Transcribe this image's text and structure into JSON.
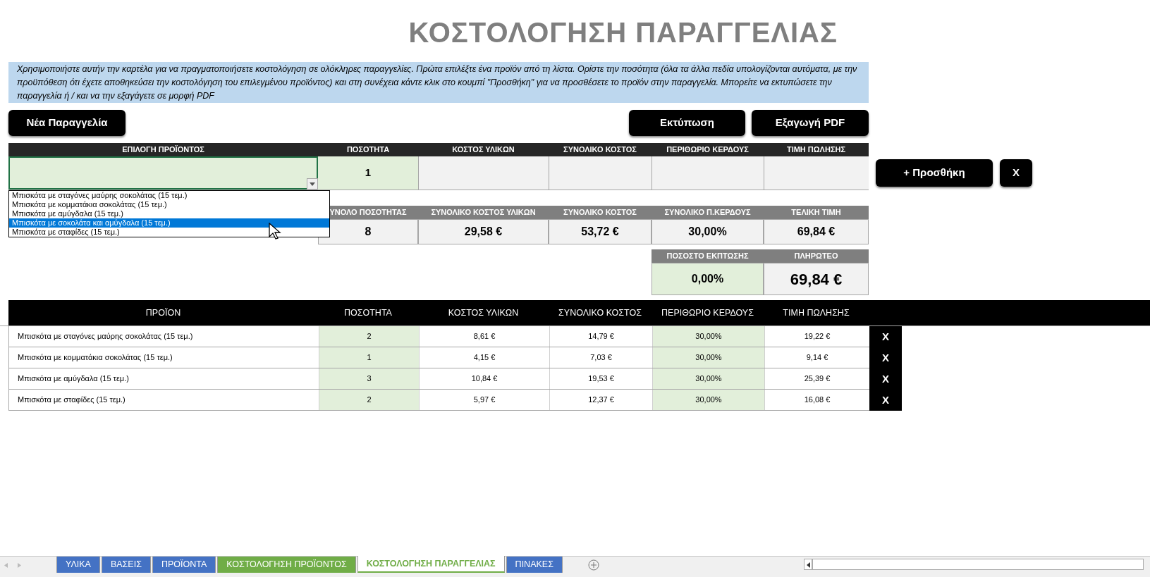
{
  "title": "ΚΟΣΤΟΛΟΓΗΣΗ ΠΑΡΑΓΓΕΛΙΑΣ",
  "info": "Χρησιμοποιήστε αυτήν την καρτέλα για να πραγματοποιήσετε κοστολόγηση σε ολόκληρες παραγγελίες. Πρώτα επιλέξτε ένα προϊόν από τη λίστα. Ορίστε την ποσότητα (όλα τα άλλα πεδία υπολογίζονται αυτόματα, με την προϋπόθεση ότι έχετε αποθηκεύσει την κοστολόγηση του επιλεγμένου προϊόντος) και στη συνέχεια κάντε κλικ στο κουμπί \"Προσθήκη\" για να προσθέσετε το προϊόν στην παραγγελία. Μπορείτε να εκτυπώσετε την παραγγελία ή / και να την εξαγάγετε σε μορφή PDF",
  "buttons": {
    "new_order": "Νέα Παραγγελία",
    "print": "Εκτύπωση",
    "export_pdf": "Εξαγωγή PDF",
    "add": "+ Προσθήκη",
    "clear": "X"
  },
  "entry": {
    "columns": [
      "ΕΠΙΛΟΓΗ ΠΡΟΪΟΝΤΟΣ",
      "ΠΟΣΟΤΗΤΑ",
      "ΚΟΣΤΟΣ ΥΛΙΚΩΝ",
      "ΣΥΝΟΛΙΚΟ ΚΟΣΤΟΣ",
      "ΠΕΡΙΘΩΡΙΟ ΚΕΡΔΟΥΣ",
      "ΤΙΜΗ ΠΩΛΗΣΗΣ"
    ],
    "quantity": "1",
    "dropdown": [
      {
        "label": "Μπισκότα με σταγόνες μαύρης σοκολάτας (15 τεμ.)",
        "selected": false
      },
      {
        "label": "Μπισκότα με κομματάκια σοκολάτας (15 τεμ.)",
        "selected": false
      },
      {
        "label": "Μπισκότα με αμύγδαλα (15 τεμ.)",
        "selected": false
      },
      {
        "label": "Μπισκότα με σοκολάτα και αμύγδαλα (15 τεμ.)",
        "selected": true
      },
      {
        "label": "Μπισκότα με σταφίδες (15 τεμ.)",
        "selected": false
      }
    ]
  },
  "summary": {
    "columns": [
      "ΥΝΟΛΟ ΠΟΣΟΤΗΤΑΣ",
      "ΣΥΝΟΛΙΚΟ ΚΟΣΤΟΣ ΥΛΙΚΩΝ",
      "ΣΥΝΟΛΙΚΟ ΚΟΣΤΟΣ",
      "ΣΥΝΟΛΙΚΟ Π.ΚΕΡΔΟΥΣ",
      "ΤΕΛΙΚΗ ΤΙΜΗ"
    ],
    "values": [
      "8",
      "29,58 €",
      "53,72 €",
      "30,00%",
      "69,84 €"
    ]
  },
  "discount": {
    "columns": [
      "ΠΟΣΟΣΤΟ ΕΚΠΤΩΣΗΣ",
      "ΠΛΗΡΩΤΕΟ"
    ],
    "values": [
      "0,00%",
      "69,84 €"
    ]
  },
  "order": {
    "columns": [
      "ΠΡΟΪΟΝ",
      "ΠΟΣΟΤΗΤΑ",
      "ΚΟΣΤΟΣ ΥΛΙΚΩΝ",
      "ΣΥΝΟΛΙΚΟ ΚΟΣΤΟΣ",
      "ΠΕΡΙΘΩΡΙΟ ΚΕΡΔΟΥΣ",
      "ΤΙΜΗ ΠΩΛΗΣΗΣ"
    ],
    "rows": [
      {
        "cells": [
          "Μπισκότα με σταγόνες μαύρης σοκολάτας (15 τεμ.)",
          "2",
          "8,61 €",
          "14,79 €",
          "30,00%",
          "19,22 €"
        ],
        "remove": "X"
      },
      {
        "cells": [
          "Μπισκότα με κομματάκια σοκολάτας (15 τεμ.)",
          "1",
          "4,15 €",
          "7,03 €",
          "30,00%",
          "9,14 €"
        ],
        "remove": "X"
      },
      {
        "cells": [
          "Μπισκότα με αμύγδαλα (15 τεμ.)",
          "3",
          "10,84 €",
          "19,53 €",
          "30,00%",
          "25,39 €"
        ],
        "remove": "X"
      },
      {
        "cells": [
          "Μπισκότα με σταφίδες (15 τεμ.)",
          "2",
          "5,97 €",
          "12,37 €",
          "30,00%",
          "16,08 €"
        ],
        "remove": "X"
      }
    ]
  },
  "sheet_tabs": [
    {
      "label": "ΥΛΙΚΑ",
      "color": "#4472c4",
      "selected": false
    },
    {
      "label": "ΒΑΣΕΙΣ",
      "color": "#4472c4",
      "selected": false
    },
    {
      "label": "ΠΡΟΪΟΝΤΑ",
      "color": "#4472c4",
      "selected": false
    },
    {
      "label": "ΚΟΣΤΟΛΟΓΗΣΗ ΠΡΟΪΟΝΤΟΣ",
      "color": "#70ad47",
      "selected": false
    },
    {
      "label": "ΚΟΣΤΟΛΟΓΗΣΗ ΠΑΡΑΓΓΕΛΙΑΣ",
      "color": "#70ad47",
      "selected": true
    },
    {
      "label": "ΠΙΝΑΚΕΣ",
      "color": "#4472c4",
      "selected": false
    }
  ]
}
